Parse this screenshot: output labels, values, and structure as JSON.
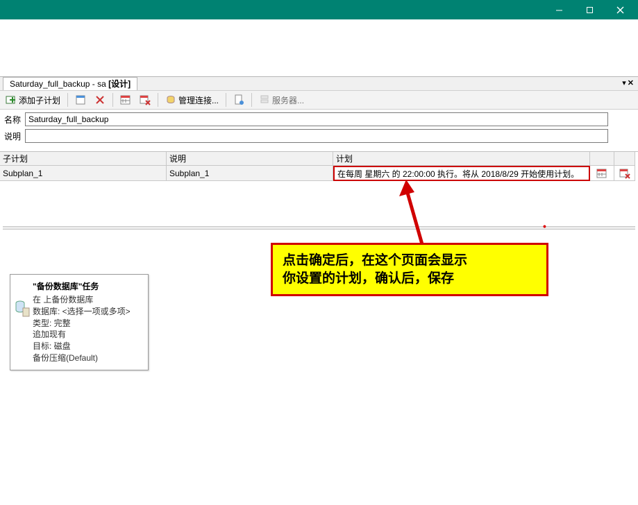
{
  "titlebar": {},
  "tab": {
    "name": "Saturday_full_backup",
    "user": "sa",
    "mode": "[设计]"
  },
  "toolbar": {
    "add_subplan": "添加子计划",
    "manage_conn": "管理连接...",
    "server": "服务器..."
  },
  "form": {
    "name_label": "名称",
    "name_value": "Saturday_full_backup",
    "desc_label": "说明",
    "desc_value": ""
  },
  "grid": {
    "headers": {
      "subplan": "子计划",
      "desc": "说明",
      "plan": "计划"
    },
    "row": {
      "subplan": "Subplan_1",
      "desc": "Subplan_1",
      "plan": "在每周 星期六 的 22:00:00 执行。将从 2018/8/29 开始使用计划。"
    }
  },
  "arrow_dot": "•",
  "callout": {
    "line1": "点击确定后，在这个页面会显示",
    "line2": "你设置的计划，确认后，保存"
  },
  "task": {
    "title": "\"备份数据库\"任务",
    "l1": "在 上备份数据库",
    "l2": "数据库: <选择一项或多项>",
    "l3": "类型: 完整",
    "l4": "追加现有",
    "l5": "目标: 磁盘",
    "l6": "备份压缩(Default)"
  }
}
